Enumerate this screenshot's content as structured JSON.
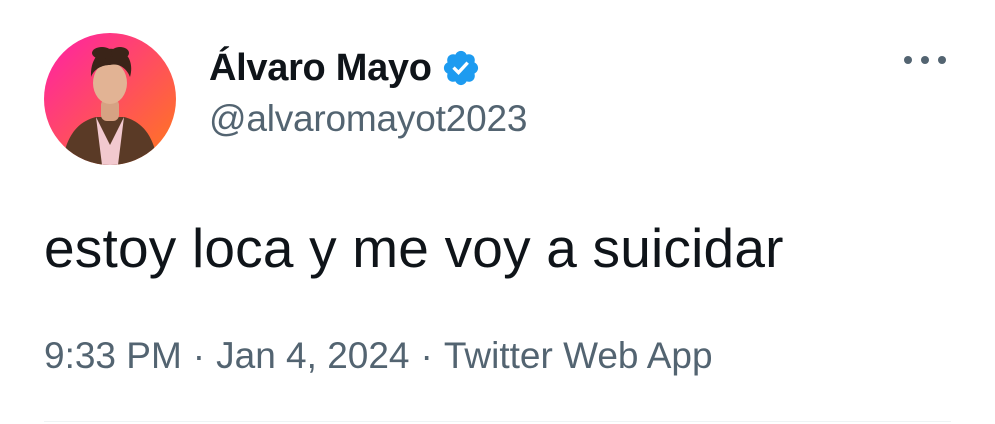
{
  "author": {
    "display_name": "Álvaro Mayo",
    "handle": "@alvaromayot2023",
    "verified": true,
    "avatar_icon": "user-avatar-photo",
    "verified_icon": "verified-badge-icon",
    "verified_color": "#1d9bf0"
  },
  "tweet": {
    "text": "estoy loca y me voy a suicidar"
  },
  "meta": {
    "time": "9:33 PM",
    "separator": "·",
    "date": "Jan 4, 2024",
    "source": "Twitter Web App"
  },
  "menu": {
    "icon": "more-options-icon"
  },
  "colors": {
    "text_primary": "#0f1419",
    "text_secondary": "#536471",
    "avatar_gradient_start": "#ff1fa8",
    "avatar_gradient_end": "#ff7a1a",
    "divider": "#eff3f4"
  }
}
